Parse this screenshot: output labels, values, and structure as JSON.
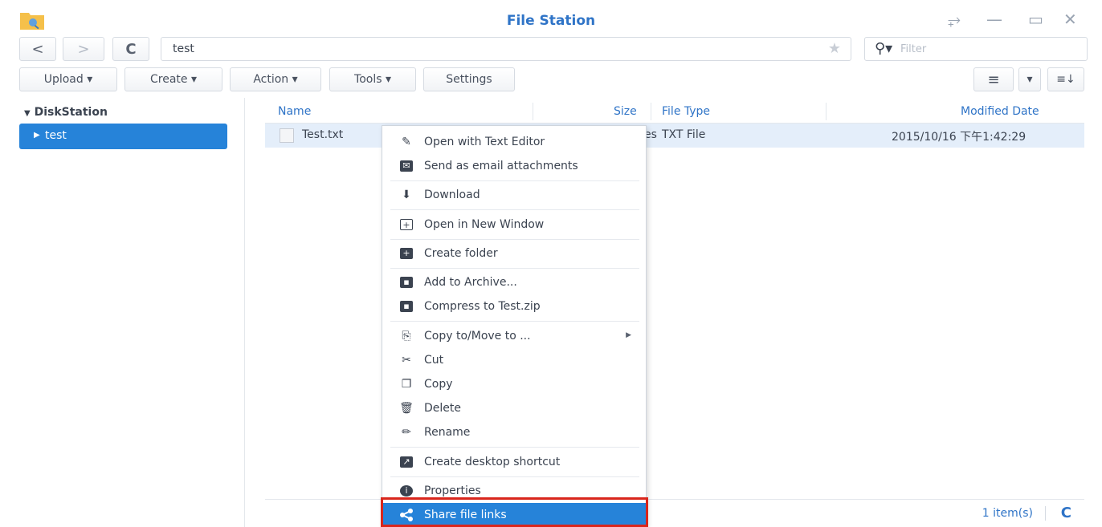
{
  "window": {
    "title": "File Station",
    "controls": {
      "pin": "⥅",
      "minimize": "—",
      "maximize": "▭",
      "close": "✕"
    }
  },
  "nav": {
    "back": "<",
    "forward": ">",
    "refresh": "C",
    "path": "test",
    "filter_placeholder": "Filter"
  },
  "toolbar": {
    "upload": "Upload ▾",
    "create": "Create ▾",
    "action": "Action ▾",
    "tools": "Tools ▾",
    "settings": "Settings",
    "view_list": "≡",
    "view_dropdown": "▾",
    "sort": "≡↓"
  },
  "tree": {
    "root": "DiskStation",
    "selected": "test"
  },
  "columns": {
    "name": "Name",
    "size": "Size",
    "file_type": "File Type",
    "modified": "Modified Date"
  },
  "file": {
    "name": "Test.txt",
    "size_fragment": "es",
    "type": "TXT File",
    "modified": "2015/10/16 下午1:42:29"
  },
  "status": {
    "count": "1 item(s)"
  },
  "menu": {
    "open_text_editor": "Open with Text Editor",
    "send_email": "Send as email attachments",
    "download": "Download",
    "open_new_window": "Open in New Window",
    "create_folder": "Create folder",
    "add_archive": "Add to Archive...",
    "compress": "Compress to Test.zip",
    "copy_move": "Copy to/Move to ...",
    "cut": "Cut",
    "copy": "Copy",
    "delete": "Delete",
    "rename": "Rename",
    "desktop_shortcut": "Create desktop shortcut",
    "properties": "Properties",
    "share_links": "Share file links"
  },
  "colors": {
    "accent": "#2683d9",
    "title_blue": "#2f74c7",
    "highlight_red": "#d9261c"
  }
}
